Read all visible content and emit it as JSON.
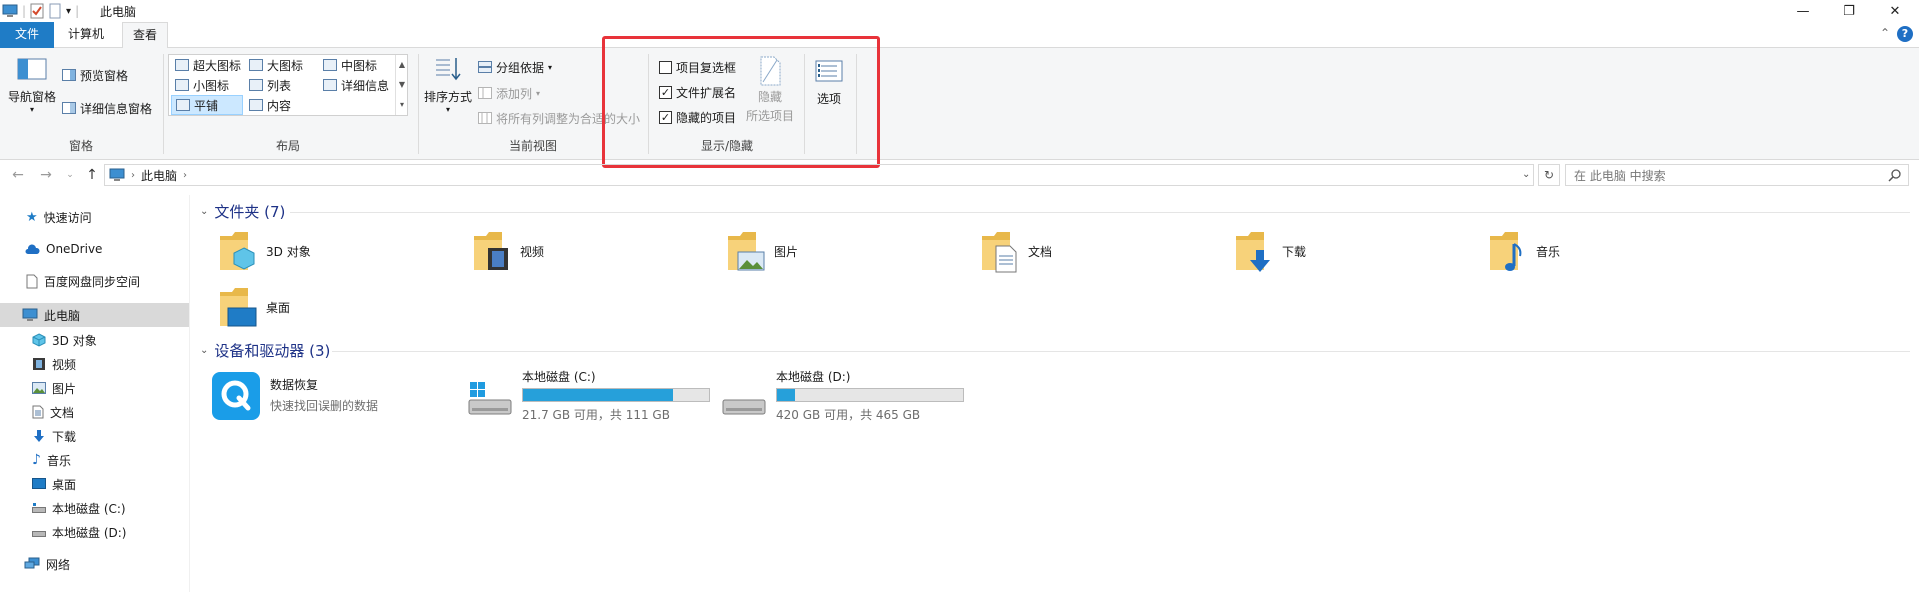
{
  "window": {
    "title": "此电脑",
    "controls": {
      "minimize": "—",
      "restore": "❐",
      "close": "✕"
    }
  },
  "ribbon": {
    "tabs": [
      "文件",
      "计算机",
      "查看"
    ],
    "active_tab": "查看",
    "collapse_glyph": "⌃",
    "help_glyph": "?",
    "panes": {
      "label": "窗格",
      "nav_pane": "导航窗格",
      "preview_pane": "预览窗格",
      "details_pane": "详细信息窗格"
    },
    "layout": {
      "label": "布局",
      "items": [
        "超大图标",
        "大图标",
        "中图标",
        "小图标",
        "列表",
        "详细信息",
        "平铺",
        "内容"
      ],
      "selected": "平铺"
    },
    "current_view": {
      "label": "当前视图",
      "sort_by": "排序方式",
      "group_by": "分组依据",
      "add_columns": "添加列",
      "size_columns": "将所有列调整为合适的大小"
    },
    "show_hide": {
      "label": "显示/隐藏",
      "item_checkboxes": {
        "label": "项目复选框",
        "checked": false
      },
      "file_extensions": {
        "label": "文件扩展名",
        "checked": true
      },
      "hidden_items": {
        "label": "隐藏的项目",
        "checked": true
      },
      "hide_selected_1": "隐藏",
      "hide_selected_2": "所选项目",
      "options": "选项"
    }
  },
  "address_bar": {
    "breadcrumb": "此电脑",
    "search_placeholder": "在 此电脑 中搜索"
  },
  "nav_pane": {
    "items": [
      {
        "label": "快速访问",
        "icon": "star-icon"
      },
      {
        "label": "OneDrive",
        "icon": "cloud-icon"
      },
      {
        "label": "百度网盘同步空间",
        "icon": "file-icon"
      },
      {
        "label": "此电脑",
        "icon": "computer-icon",
        "selected": true
      },
      {
        "label": "3D 对象",
        "icon": "cube-icon"
      },
      {
        "label": "视频",
        "icon": "video-icon"
      },
      {
        "label": "图片",
        "icon": "picture-icon"
      },
      {
        "label": "文档",
        "icon": "document-icon"
      },
      {
        "label": "下载",
        "icon": "download-icon"
      },
      {
        "label": "音乐",
        "icon": "music-icon"
      },
      {
        "label": "桌面",
        "icon": "desktop-icon"
      },
      {
        "label": "本地磁盘 (C:)",
        "icon": "drive-icon"
      },
      {
        "label": "本地磁盘 (D:)",
        "icon": "drive-icon"
      },
      {
        "label": "网络",
        "icon": "network-icon"
      }
    ]
  },
  "content": {
    "folders_header": "文件夹 (7)",
    "folders": [
      "3D 对象",
      "视频",
      "图片",
      "文档",
      "下载",
      "音乐",
      "桌面"
    ],
    "devices_header": "设备和驱动器 (3)",
    "app": {
      "name": "数据恢复",
      "desc": "快速找回误删的数据"
    },
    "drives": [
      {
        "name": "本地磁盘 (C:)",
        "info": "21.7 GB 可用，共 111 GB",
        "used_fraction": 0.805
      },
      {
        "name": "本地磁盘 (D:)",
        "info": "420 GB 可用，共 465 GB",
        "used_fraction": 0.097
      }
    ]
  },
  "colors": {
    "accent": "#1f7cc6",
    "highlight_border": "#e8333a",
    "drive_bar": "#26a0da",
    "section_header": "#1e3287"
  }
}
